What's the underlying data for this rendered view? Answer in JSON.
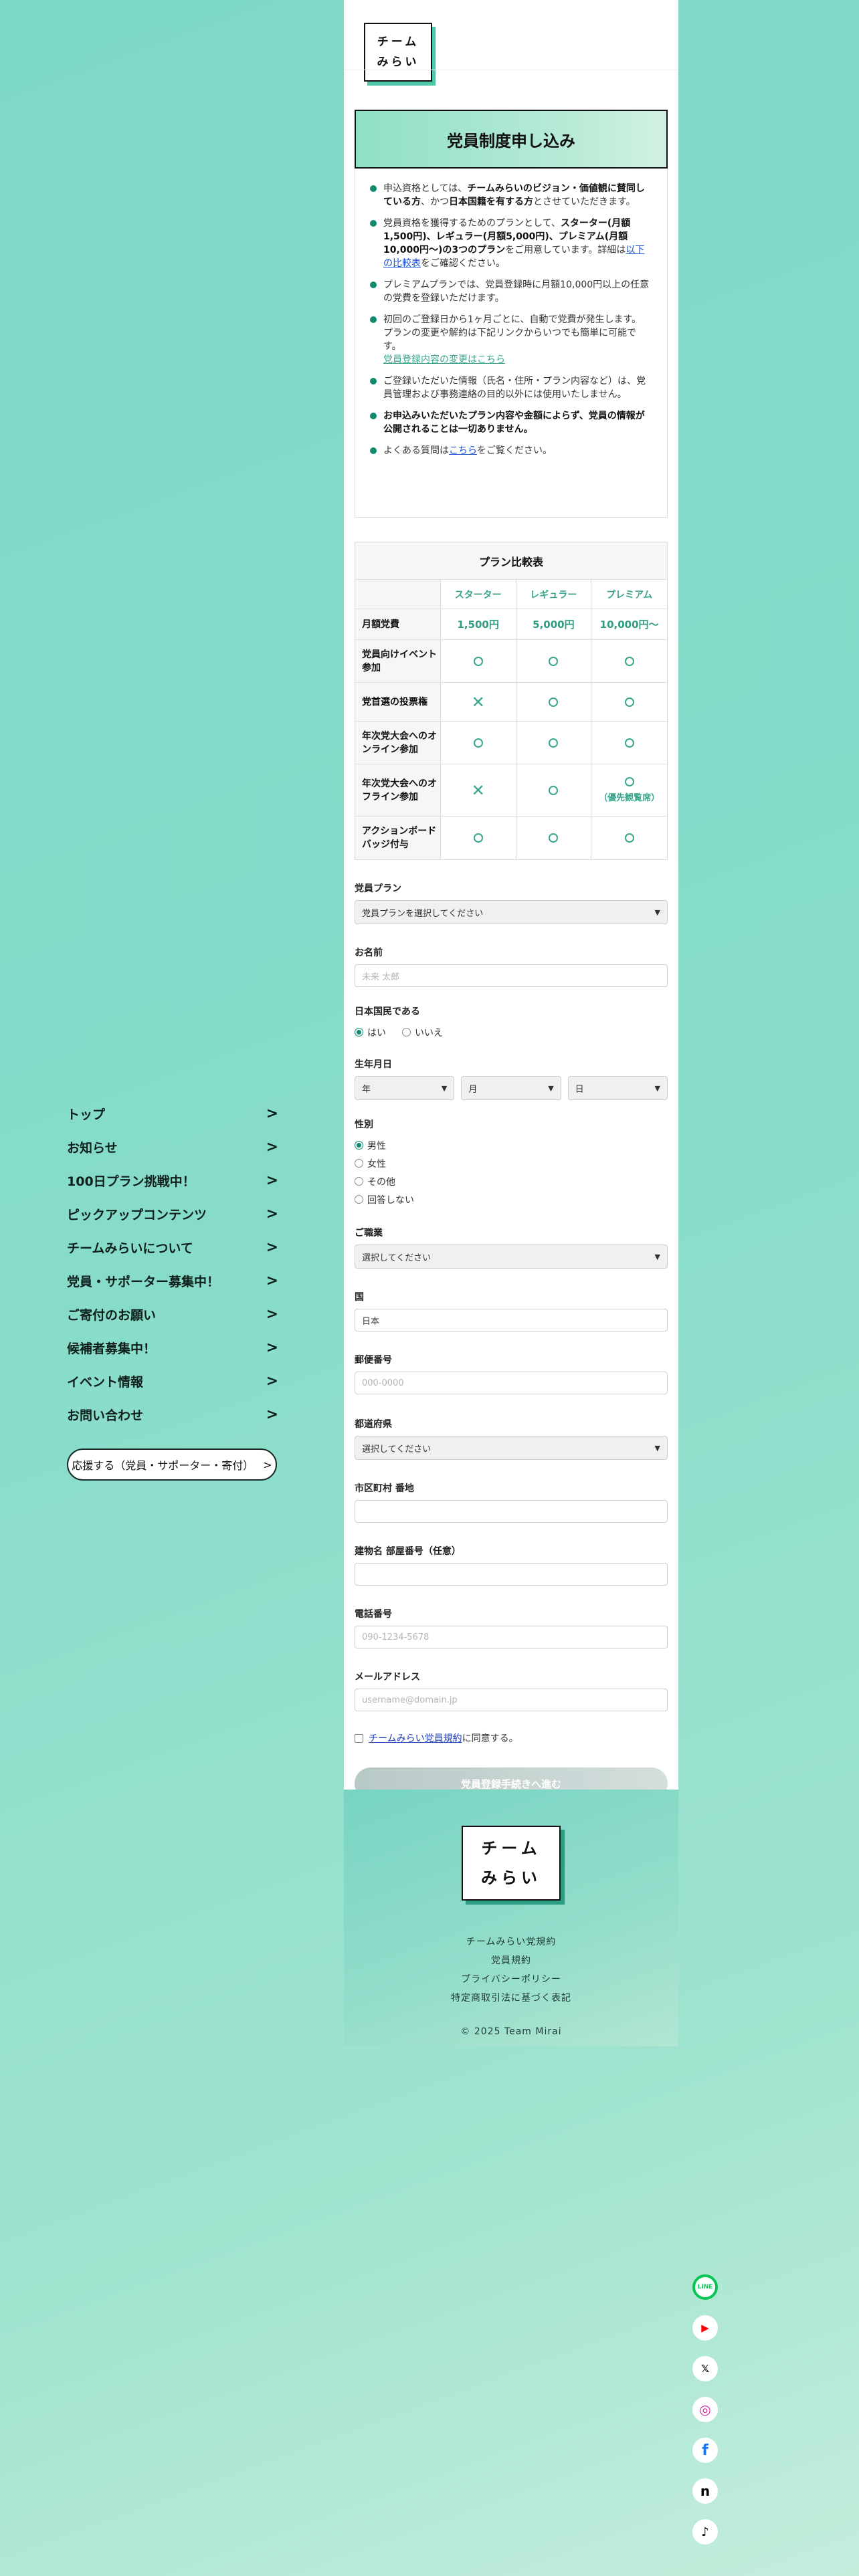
{
  "nav": {
    "items": [
      {
        "label": "トップ"
      },
      {
        "label": "お知らせ"
      },
      {
        "label": "100日プラン挑戦中！"
      },
      {
        "label": "ピックアップコンテンツ"
      },
      {
        "label": "チームみらいについて"
      },
      {
        "label": "党員・サポーター募集中！"
      },
      {
        "label": "ご寄付のお願い"
      },
      {
        "label": "候補者募集中！"
      },
      {
        "label": "イベント情報"
      },
      {
        "label": "お問い合わせ"
      }
    ],
    "chevron": ">",
    "support_button": {
      "label": "応援する（党員・サポーター・寄付）",
      "chevron": ">"
    }
  },
  "header": {
    "logo_line1": "チーム",
    "logo_line2": "みらい"
  },
  "title": "党員制度申し込み",
  "info": {
    "item1": {
      "pre": "申込資格としては、",
      "bold": "チームみらいのビジョン・価値観に賛同している方",
      "mid": "、かつ",
      "bold2": "日本国籍を有する方",
      "post": "とさせていただきます。"
    },
    "item2": {
      "pre": "党員資格を獲得するためのプランとして、",
      "bold": "スターター(月額1,500円)、レギュラー(月額5,000円)、プレミアム(月額10,000円〜)の3つのプラン",
      "mid": "をご用意しています。詳細は",
      "link": "以下の比較表",
      "post": "をご確認ください。"
    },
    "item3": "プレミアムプランでは、党員登録時に月額10,000円以上の任意の党費を登録いただけます。",
    "item4": {
      "text": "初回のご登録日から1ヶ月ごとに、自動で党費が発生します。 プランの変更や解約は下記リンクからいつでも簡単に可能です。",
      "link": "党員登録内容の変更はこちら"
    },
    "item5": "ご登録いただいた情報（氏名・住所・プラン内容など）は、党員管理および事務連絡の目的以外には使用いたしません。",
    "item6": "お申込みいただいたプラン内容や金額によらず、党員の情報が公開されることは一切ありません。",
    "item7": {
      "pre": "よくある質問は",
      "link": "こちら",
      "post": "をご覧ください。"
    }
  },
  "plan_table": {
    "title": "プラン比較表",
    "plans": [
      "スターター",
      "レギュラー",
      "プレミアム"
    ],
    "rows": [
      {
        "label": "月額党費",
        "values": [
          "1,500円",
          "5,000円",
          "10,000円〜"
        ]
      },
      {
        "label": "党員向けイベント参加",
        "marks": [
          "circle",
          "circle",
          "circle"
        ]
      },
      {
        "label": "党首選の投票権",
        "marks": [
          "cross",
          "circle",
          "circle"
        ]
      },
      {
        "label": "年次党大会へのオンライン参加",
        "marks": [
          "circle",
          "circle",
          "circle"
        ]
      },
      {
        "label": "年次党大会へのオフライン参加",
        "marks": [
          "cross",
          "circle",
          "circle"
        ],
        "note": "（優先観覧席）"
      },
      {
        "label": "アクションボードバッジ付与",
        "marks": [
          "circle",
          "circle",
          "circle"
        ]
      }
    ],
    "cross_glyph": "✕"
  },
  "form": {
    "plan": {
      "label": "党員プラン",
      "value": "党員プランを選択してください"
    },
    "name": {
      "label": "お名前",
      "placeholder": "未来 太郎"
    },
    "citizen": {
      "label": "日本国民である",
      "options": [
        "はい",
        "いいえ"
      ],
      "selected": "はい"
    },
    "dob": {
      "label": "生年月日",
      "year": "年",
      "month": "月",
      "day": "日"
    },
    "gender": {
      "label": "性別",
      "options": [
        "男性",
        "女性",
        "その他",
        "回答しない"
      ],
      "selected": "男性"
    },
    "occupation": {
      "label": "ご職業",
      "value": "選択してください"
    },
    "country": {
      "label": "国",
      "value": "日本"
    },
    "postal": {
      "label": "郵便番号",
      "placeholder": "000-0000"
    },
    "prefecture": {
      "label": "都道府県",
      "value": "選択してください"
    },
    "city": {
      "label": "市区町村 番地",
      "placeholder": ""
    },
    "building": {
      "label": "建物名 部屋番号（任意）",
      "placeholder": ""
    },
    "phone": {
      "label": "電話番号",
      "placeholder": "090-1234-5678"
    },
    "email": {
      "label": "メールアドレス",
      "placeholder": "username@domain.jp"
    },
    "agree": {
      "link": "チームみらい党員規約",
      "post": "に同意する。"
    },
    "submit": "党員登録手続きへ進む"
  },
  "footer": {
    "logo_line1": "チーム",
    "logo_line2": "みらい",
    "links": [
      "チームみらい党規約",
      "党員規約",
      "プライバシーポリシー",
      "特定商取引法に基づく表記"
    ],
    "copyright": "© 2025 Team Mirai"
  },
  "social": [
    {
      "name": "line-icon",
      "glyph": "LINE",
      "color": "#06c755"
    },
    {
      "name": "youtube-icon",
      "glyph": "▶",
      "color": "#ff0000"
    },
    {
      "name": "x-icon",
      "glyph": "𝕏",
      "color": "#000000"
    },
    {
      "name": "instagram-icon",
      "glyph": "◎",
      "color": "#d6249f"
    },
    {
      "name": "facebook-icon",
      "glyph": "f",
      "color": "#1877f2"
    },
    {
      "name": "note-icon",
      "glyph": "n",
      "color": "#000000"
    },
    {
      "name": "tiktok-icon",
      "glyph": "♪",
      "color": "#000000"
    }
  ]
}
